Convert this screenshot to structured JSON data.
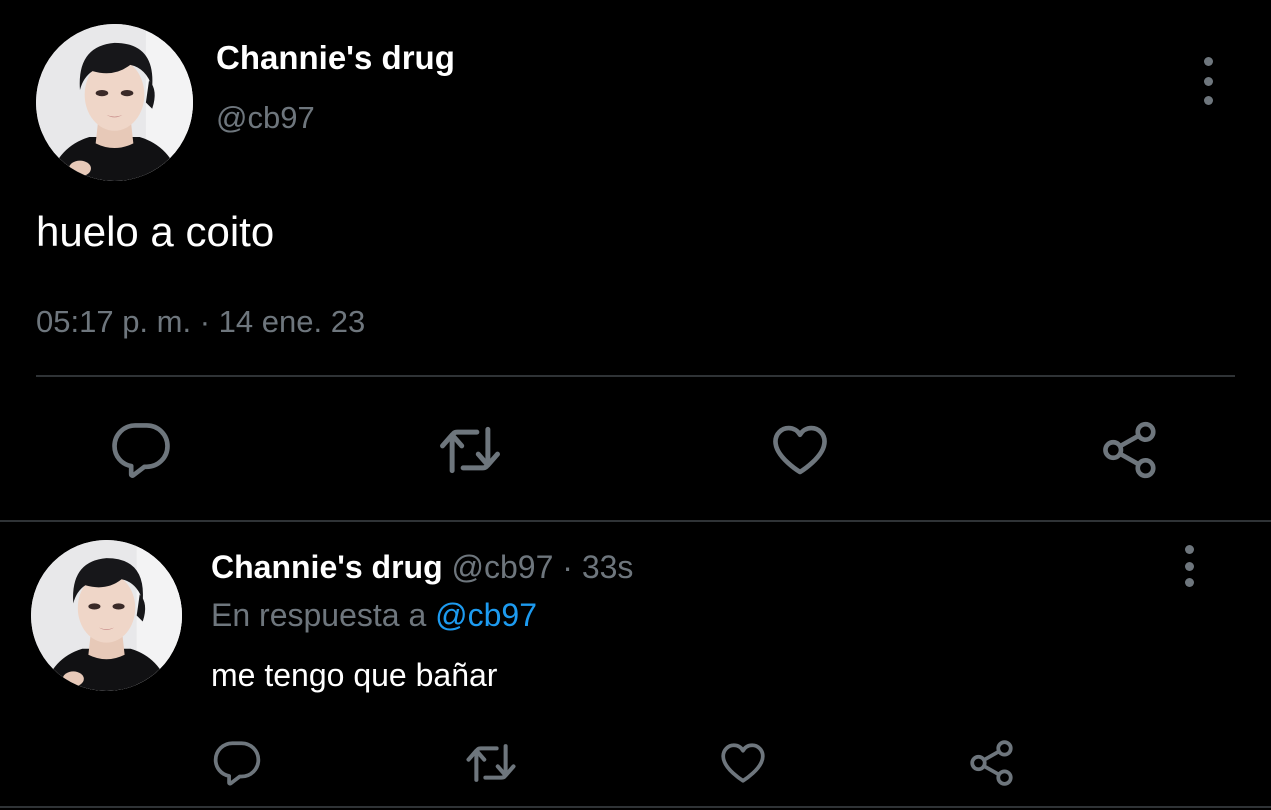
{
  "colors": {
    "background": "#000000",
    "text_primary": "#ffffff",
    "text_secondary": "#6e767d",
    "link": "#1d9bf0",
    "divider": "#2f3336"
  },
  "main_tweet": {
    "display_name": "Channie's drug",
    "handle": "@cb97",
    "text": "huelo a coito",
    "time": "05:17 p. m.",
    "separator": "·",
    "date": "14 ene. 23",
    "avatar_icon": "profile-photo",
    "more_icon": "more-vertical-icon",
    "actions": [
      "reply-icon",
      "retweet-icon",
      "like-icon",
      "share-icon"
    ]
  },
  "reply_tweet": {
    "display_name": "Channie's drug",
    "handle": "@cb97",
    "separator": "·",
    "time_ago": "33s",
    "reply_prefix": "En respuesta a",
    "reply_mention": "@cb97",
    "text": "me tengo que bañar",
    "avatar_icon": "profile-photo",
    "more_icon": "more-vertical-icon",
    "actions": [
      "reply-icon",
      "retweet-icon",
      "like-icon",
      "share-icon"
    ]
  }
}
